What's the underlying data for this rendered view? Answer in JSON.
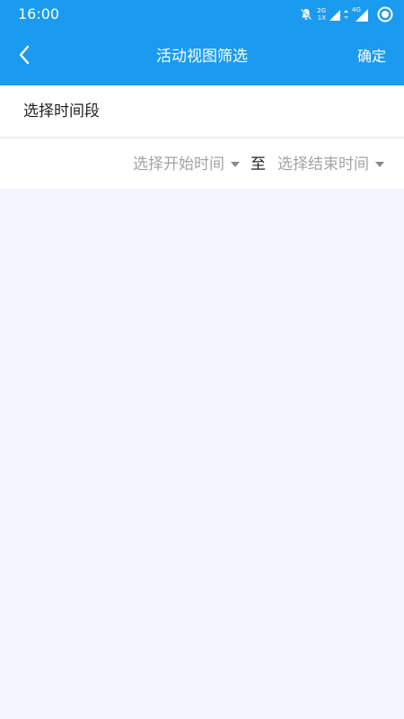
{
  "status_bar": {
    "time": "16:00",
    "network_top": "2G",
    "network_bottom": "1X",
    "network_4g": "4G",
    "icons": [
      "notification-off-icon",
      "signal-icon",
      "signal-4g-icon",
      "record-icon"
    ]
  },
  "nav": {
    "back_icon": "chevron-left-icon",
    "title": "活动视图筛选",
    "confirm_label": "确定"
  },
  "filter": {
    "section_label": "选择时间段",
    "start_placeholder": "选择开始时间",
    "to_label": "至",
    "end_placeholder": "选择结束时间"
  },
  "colors": {
    "primary": "#1a9bf0",
    "background": "#f4f5fd",
    "placeholder": "#a3a3a3"
  }
}
